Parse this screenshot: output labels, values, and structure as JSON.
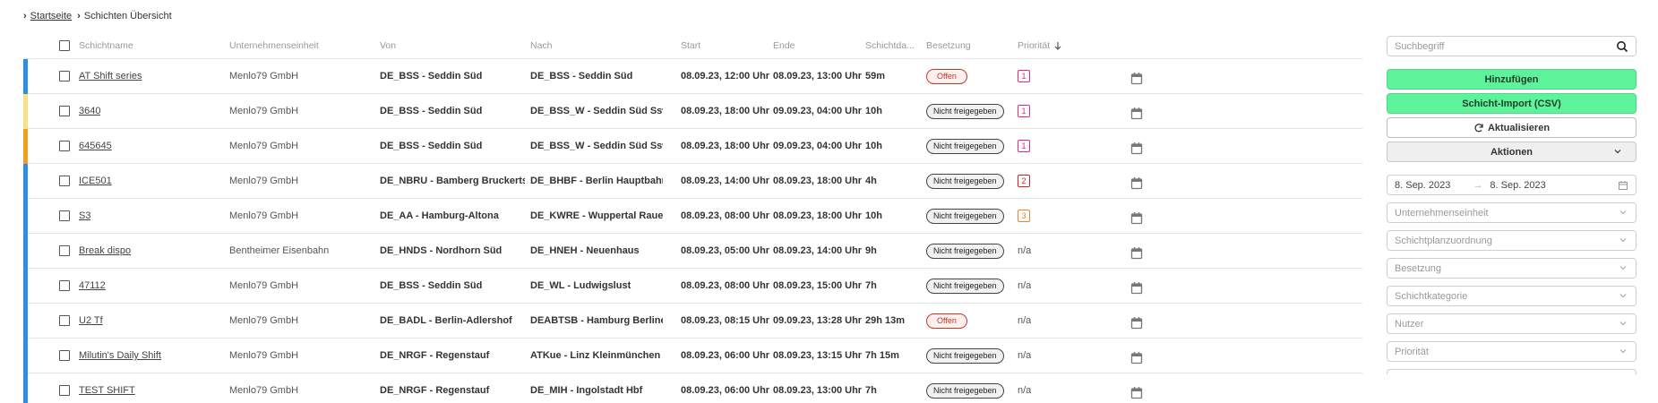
{
  "breadcrumb": {
    "home": "Startseite",
    "current": "Schichten Übersicht"
  },
  "table": {
    "headers": {
      "name": "Schichtname",
      "unit": "Unternehmenseinheit",
      "from": "Von",
      "to": "Nach",
      "start": "Start",
      "end": "Ende",
      "duration": "Schichtda...",
      "occupancy": "Besetzung",
      "priority": "Priorität"
    },
    "rows": [
      {
        "name": "AT Shift series",
        "unit": "Menlo79 GmbH",
        "from": "DE_BSS - Seddin Süd",
        "to": "DE_BSS - Seddin Süd",
        "start": "08.09.23, 12:00 Uhr",
        "end": "08.09.23, 13:00 Uhr",
        "duration": "59m",
        "occupancy": "Offen",
        "priority": "1"
      },
      {
        "name": "3640",
        "unit": "Menlo79 GmbH",
        "from": "DE_BSS - Seddin Süd",
        "to": "DE_BSS_W - Seddin Süd Ssw",
        "start": "08.09.23, 18:00 Uhr",
        "end": "09.09.23, 04:00 Uhr",
        "duration": "10h",
        "occupancy": "Nicht freigegeben",
        "priority": "1"
      },
      {
        "name": "645645",
        "unit": "Menlo79 GmbH",
        "from": "DE_BSS - Seddin Süd",
        "to": "DE_BSS_W - Seddin Süd Ssw",
        "start": "08.09.23, 18:00 Uhr",
        "end": "09.09.23, 04:00 Uhr",
        "duration": "10h",
        "occupancy": "Nicht freigegeben",
        "priority": "1"
      },
      {
        "name": "ICE501",
        "unit": "Menlo79 GmbH",
        "from": "DE_NBRU - Bamberg Bruckertshof",
        "to": "DE_BHBF - Berlin Hauptbahnhof - Lehrter Bahnhof",
        "start": "08.09.23, 14:00 Uhr",
        "end": "08.09.23, 18:00 Uhr",
        "duration": "4h",
        "occupancy": "Nicht freigegeben",
        "priority": "2"
      },
      {
        "name": "S3",
        "unit": "Menlo79 GmbH",
        "from": "DE_AA - Hamburg-Altona",
        "to": "DE_KWRE - Wuppertal Rauenthal Eisenbahn",
        "start": "08.09.23, 08:00 Uhr",
        "end": "08.09.23, 18:00 Uhr",
        "duration": "10h",
        "occupancy": "Nicht freigegeben",
        "priority": "3"
      },
      {
        "name": "Break dispo",
        "unit": "Bentheimer Eisenbahn",
        "from": "DE_HNDS - Nordhorn Süd",
        "to": "DE_HNEH - Neuenhaus",
        "start": "08.09.23, 05:00 Uhr",
        "end": "08.09.23, 14:00 Uhr",
        "duration": "9h",
        "occupancy": "Nicht freigegeben",
        "priority": "n/a"
      },
      {
        "name": "47112",
        "unit": "Menlo79 GmbH",
        "from": "DE_BSS - Seddin Süd",
        "to": "DE_WL - Ludwigslust",
        "start": "08.09.23, 08:00 Uhr",
        "end": "08.09.23, 15:00 Uhr",
        "duration": "7h",
        "occupancy": "Nicht freigegeben",
        "priority": "n/a"
      },
      {
        "name": "U2 Tf",
        "unit": "Menlo79 GmbH",
        "from": "DE_BADL - Berlin-Adlershof",
        "to": "DEABTSB - Hamburg Berliner Tor (Bft)",
        "start": "08.09.23, 08:15 Uhr",
        "end": "09.09.23, 13:28 Uhr",
        "duration": "29h 13m",
        "occupancy": "Offen",
        "priority": "n/a"
      },
      {
        "name": "Milutin's Daily Shift",
        "unit": "Menlo79 GmbH",
        "from": "DE_NRGF - Regenstauf",
        "to": "ATKue - Linz Kleinmünchen",
        "start": "08.09.23, 06:00 Uhr",
        "end": "08.09.23, 13:15 Uhr",
        "duration": "7h 15m",
        "occupancy": "Nicht freigegeben",
        "priority": "n/a"
      },
      {
        "name": "TEST SHIFT",
        "unit": "Menlo79 GmbH",
        "from": "DE_NRGF - Regenstauf",
        "to": "DE_MIH - Ingolstadt Hbf",
        "start": "08.09.23, 06:00 Uhr",
        "end": "08.09.23, 13:00 Uhr",
        "duration": "7h",
        "occupancy": "Nicht freigegeben",
        "priority": "n/a"
      }
    ]
  },
  "row_colors": [
    "#2f8ee0",
    "#f7e08a",
    "#f0a020",
    "#2f8ee0",
    "#2f8ee0",
    "#2f8ee0",
    "#2f8ee0",
    "#2f8ee0",
    "#2f8ee0",
    "#2f8ee0"
  ],
  "priority_colors": {
    "1": "#e0287c",
    "2": "#e02020",
    "3": "#f08030"
  },
  "panel": {
    "search_placeholder": "Suchbegriff",
    "add_label": "Hinzufügen",
    "import_label": "Schicht-Import (CSV)",
    "refresh_label": "Aktualisieren",
    "actions_label": "Aktionen",
    "date_from": "8. Sep. 2023",
    "date_to": "8. Sep. 2023",
    "filters": [
      "Unternehmenseinheit",
      "Schichtplanzuordnung",
      "Besetzung",
      "Schichtkategorie",
      "Nutzer",
      "Priorität"
    ]
  },
  "icons": {
    "search": "search-icon",
    "refresh": "refresh-icon",
    "calendar": "calendar-icon",
    "chevron": "chevron-down-icon",
    "sort": "arrow-down-icon"
  },
  "accent_colors": {
    "button_green": "#5cf39a",
    "offen_red": "#c0392b"
  }
}
